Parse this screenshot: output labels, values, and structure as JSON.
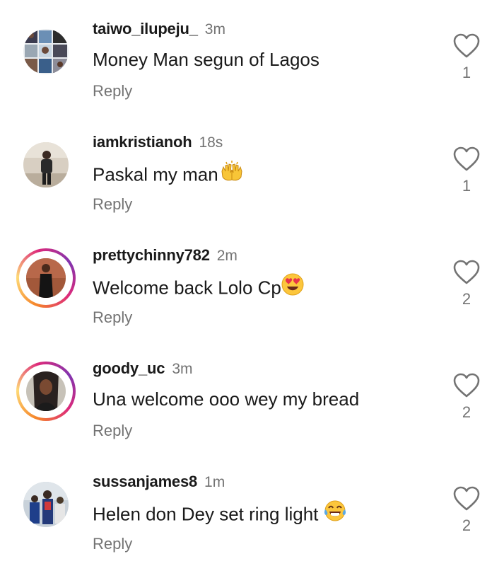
{
  "comments": [
    {
      "username": "taiwo_ilupeju_",
      "time": "3m",
      "text": "Money Man segun of Lagos",
      "emoji": "",
      "reply_label": "Reply",
      "likes": "1",
      "story_ring": false,
      "avatar_icon": "group-photo-collage"
    },
    {
      "username": "iamkristianoh",
      "time": "18s",
      "text": "Paskal my man",
      "emoji": "raising-hands-emoji",
      "reply_label": "Reply",
      "likes": "1",
      "story_ring": false,
      "avatar_icon": "man-standing-photo"
    },
    {
      "username": "prettychinny782",
      "time": "2m",
      "text": "Welcome back Lolo Cp",
      "emoji": "heart-eyes-emoji",
      "reply_label": "Reply",
      "likes": "2",
      "story_ring": true,
      "avatar_icon": "woman-black-dress-photo"
    },
    {
      "username": "goody_uc",
      "time": "3m",
      "text": "Una welcome ooo wey my bread",
      "emoji": "",
      "reply_label": "Reply",
      "likes": "2",
      "story_ring": true,
      "avatar_icon": "woman-portrait-photo"
    },
    {
      "username": "sussanjames8",
      "time": "1m",
      "text": "Helen don Dey set ring light",
      "emoji": "tears-of-joy-emoji",
      "reply_label": "Reply",
      "likes": "2",
      "story_ring": false,
      "avatar_icon": "graduation-photo"
    }
  ],
  "colors": {
    "primary_text": "#1a1a1a",
    "secondary_text": "#737373",
    "story_gradient": [
      "#f58529",
      "#dd2a7b",
      "#8134af"
    ]
  }
}
